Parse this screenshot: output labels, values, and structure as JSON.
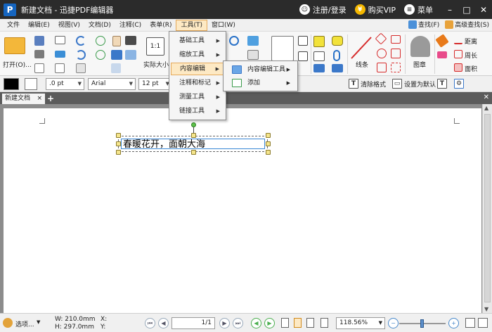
{
  "window": {
    "app_logo": "P",
    "title": "新建文档 - 迅捷PDF编辑器",
    "login": "注册/登录",
    "buy": "购买VIP",
    "menu": "菜单",
    "login_icon_glyph": "☺",
    "buy_icon_glyph": "¥",
    "menu_icon_glyph": "≡",
    "minimize_glyph": "–",
    "maximize_glyph": "□",
    "close_glyph": "✕"
  },
  "menubar": {
    "items": [
      "文件",
      "编辑(E)",
      "视图(V)",
      "文档(D)",
      "注释(C)",
      "表单(R)",
      "工具(T)",
      "窗口(W)"
    ],
    "active_index": 6,
    "find": "查找(F)",
    "advanced_find": "高级查找(S)"
  },
  "ribbon": {
    "open_label": "打开(O)...",
    "actual_size_label": "实际大小",
    "actual_size_glyph": "1:1",
    "line_label": "线条",
    "stamp_label": "图章",
    "distance_label": "距离",
    "perimeter_label": "周长",
    "area_label": "面积"
  },
  "formatbar": {
    "color": "#000000",
    "line_width": ".0 pt",
    "font_family": "Arial",
    "font_size": "12 pt",
    "clear_format": "清除格式",
    "set_default": "设置为默认"
  },
  "tabs": {
    "document_tab": "新建文档",
    "close_glyph": "×",
    "add_glyph": "+",
    "close_all_glyph": "✕"
  },
  "document": {
    "text": "春暖花开，面朝大海"
  },
  "tools_menu": {
    "items": [
      {
        "label": "基础工具"
      },
      {
        "label": "缩放工具"
      },
      {
        "label": "内容编辑"
      },
      {
        "label": "注释和标记"
      },
      {
        "label": "测量工具"
      },
      {
        "label": "链接工具"
      }
    ],
    "highlight_index": 2
  },
  "content_edit_submenu": {
    "items": [
      {
        "label": "内容编辑工具",
        "icon": "content-edit-tool-icon"
      },
      {
        "label": "添加",
        "icon": "add-content-icon"
      }
    ]
  },
  "statusbar": {
    "options": "选项...",
    "width": "W: 210.0mm",
    "height": "H: 297.0mm",
    "x": "X:",
    "y": "Y:",
    "page": "1/1",
    "zoom": "118.56%"
  }
}
